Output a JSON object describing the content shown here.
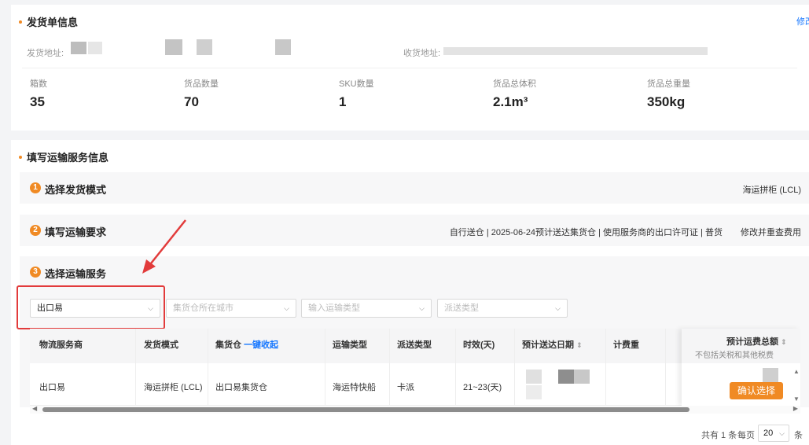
{
  "shipment": {
    "title": "发货单信息",
    "edit_label": "修改",
    "ship_address_label": "发货地址:",
    "recv_address_label": "收货地址:",
    "stats": [
      {
        "label": "箱数",
        "value": "35"
      },
      {
        "label": "货品数量",
        "value": "70"
      },
      {
        "label": "SKU数量",
        "value": "1"
      },
      {
        "label": "货品总体积",
        "value": "2.1m³"
      },
      {
        "label": "货品总重量",
        "value": "350kg"
      }
    ]
  },
  "transport": {
    "title": "填写运输服务信息",
    "steps": [
      {
        "num": "1",
        "title": "选择发货模式",
        "right": "海运拼柜 (LCL)"
      },
      {
        "num": "2",
        "title": "填写运输要求",
        "right": "自行送仓 | 2025-06-24预计送达集货仓 | 使用服务商的出口许可证 | 普货",
        "action": "修改并重查费用"
      },
      {
        "num": "3",
        "title": "选择运输服务"
      }
    ]
  },
  "filters": {
    "provider": "出口易",
    "city_placeholder": "集货仓所在城市",
    "transport_placeholder": "输入运输类型",
    "delivery_placeholder": "派送类型"
  },
  "table": {
    "headers": {
      "provider": "物流服务商",
      "mode": "发货模式",
      "warehouse": "集货仓",
      "collapse": "一键收起",
      "transport": "运输类型",
      "delivery": "派送类型",
      "duration": "时效(天)",
      "eta": "预计送达日期",
      "billing": "计费重",
      "total": "预计运费总额",
      "total_note": "不包括关税和其他税费"
    },
    "row": {
      "provider": "出口易",
      "mode": "海运拼柜 (LCL)",
      "warehouse": "出口易集货仓",
      "transport": "海运特快船",
      "delivery": "卡派",
      "duration": "21~23(天)",
      "confirm": "确认选择"
    }
  },
  "pagination": {
    "total_text": "共有 1 条",
    "per_page_label": "每页",
    "per_page": "20",
    "unit": "条"
  },
  "colors": {
    "accent": "#f08a24",
    "link": "#1677ff",
    "highlight": "#e23b3b"
  }
}
